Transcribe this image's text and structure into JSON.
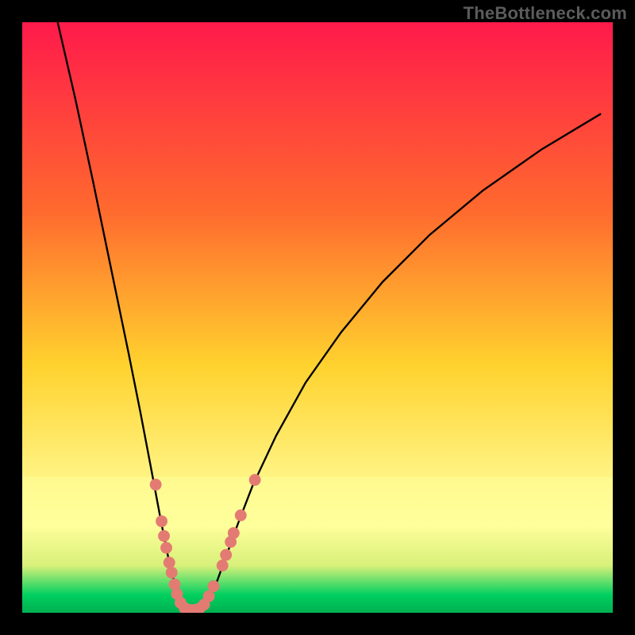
{
  "watermark": "TheBottleneck.com",
  "colors": {
    "black": "#000000",
    "curve": "#000000",
    "dots": "#e37b73",
    "watermark": "#5c5c5c",
    "gradient": {
      "top": "#ff1a4b",
      "mid1": "#ff6a2e",
      "mid2": "#ffd22e",
      "mid3": "#fff07a",
      "band": "#ffff9b",
      "green1": "#d8f07a",
      "green2": "#00d060",
      "green3": "#00b050"
    }
  },
  "chart_data": {
    "type": "line",
    "title": "",
    "xlabel": "",
    "ylabel": "",
    "xlim": [
      0,
      1000
    ],
    "ylim": [
      0,
      1000
    ],
    "curve": [
      {
        "x": 60,
        "y": 1000
      },
      {
        "x": 90,
        "y": 870
      },
      {
        "x": 120,
        "y": 730
      },
      {
        "x": 150,
        "y": 585
      },
      {
        "x": 180,
        "y": 440
      },
      {
        "x": 200,
        "y": 340
      },
      {
        "x": 220,
        "y": 235
      },
      {
        "x": 235,
        "y": 155
      },
      {
        "x": 250,
        "y": 80
      },
      {
        "x": 262,
        "y": 35
      },
      {
        "x": 272,
        "y": 12
      },
      {
        "x": 282,
        "y": 5
      },
      {
        "x": 298,
        "y": 5
      },
      {
        "x": 310,
        "y": 14
      },
      {
        "x": 325,
        "y": 40
      },
      {
        "x": 345,
        "y": 95
      },
      {
        "x": 365,
        "y": 150
      },
      {
        "x": 390,
        "y": 215
      },
      {
        "x": 430,
        "y": 300
      },
      {
        "x": 480,
        "y": 390
      },
      {
        "x": 540,
        "y": 475
      },
      {
        "x": 610,
        "y": 560
      },
      {
        "x": 690,
        "y": 640
      },
      {
        "x": 780,
        "y": 715
      },
      {
        "x": 880,
        "y": 785
      },
      {
        "x": 980,
        "y": 845
      }
    ],
    "dots": [
      {
        "x": 226,
        "y": 217
      },
      {
        "x": 236,
        "y": 155
      },
      {
        "x": 240,
        "y": 130
      },
      {
        "x": 244,
        "y": 110
      },
      {
        "x": 249,
        "y": 85
      },
      {
        "x": 253,
        "y": 68
      },
      {
        "x": 258,
        "y": 48
      },
      {
        "x": 262,
        "y": 32
      },
      {
        "x": 268,
        "y": 17
      },
      {
        "x": 275,
        "y": 8
      },
      {
        "x": 283,
        "y": 5
      },
      {
        "x": 292,
        "y": 5
      },
      {
        "x": 300,
        "y": 7
      },
      {
        "x": 308,
        "y": 14
      },
      {
        "x": 316,
        "y": 28
      },
      {
        "x": 324,
        "y": 45
      },
      {
        "x": 339,
        "y": 80
      },
      {
        "x": 345,
        "y": 98
      },
      {
        "x": 353,
        "y": 120
      },
      {
        "x": 358,
        "y": 135
      },
      {
        "x": 370,
        "y": 165
      },
      {
        "x": 394,
        "y": 225
      }
    ],
    "dot_radius": 10,
    "legend": [],
    "annotations": []
  }
}
